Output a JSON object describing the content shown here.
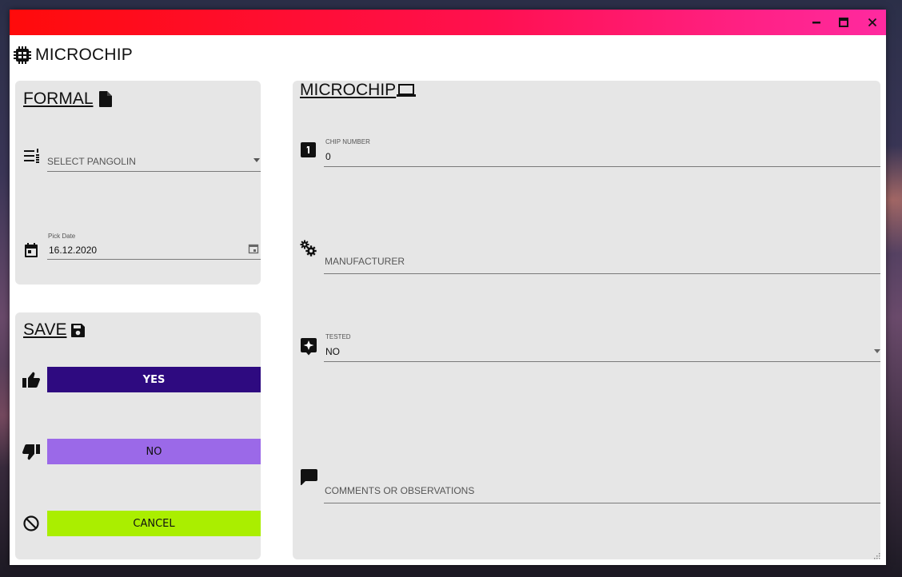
{
  "app": {
    "title": "MICROCHIP",
    "header_icon": "microchip-icon"
  },
  "window_controls": [
    "minimize-icon",
    "maximize-icon",
    "close-icon"
  ],
  "formal_card": {
    "title": "FORMAL",
    "title_icon": "file-icon",
    "pangolin_select": {
      "icon": "list-number-icon",
      "placeholder": "SELECT PANGOLIN",
      "value": ""
    },
    "date_picker": {
      "icon": "calendar-icon",
      "label": "Pick Date",
      "value": "16.12.2020"
    }
  },
  "save_card": {
    "title": "SAVE",
    "title_icon": "floppy-disk-icon",
    "buttons": [
      {
        "label": "YES",
        "icon": "thumbs-up-icon",
        "color": "#2e0a80",
        "text_color": "#ffffff"
      },
      {
        "label": "NO",
        "icon": "thumbs-down-icon",
        "color": "#9b69e8",
        "text_color": "#111111"
      },
      {
        "label": "CANCEL",
        "icon": "cancel-icon",
        "color": "#aaee00",
        "text_color": "#111111"
      }
    ]
  },
  "microchip_card": {
    "title": "MICROCHIP",
    "title_icon": "laptop-icon",
    "chip_number": {
      "icon": "numeric-one-box-icon",
      "label": "CHIP NUMBER",
      "value": "0"
    },
    "manufacturer": {
      "icon": "gears-icon",
      "placeholder": "MANUFACTURER",
      "value": ""
    },
    "tested": {
      "icon": "star-message-icon",
      "label": "TESTED",
      "value": "NO"
    },
    "comments": {
      "icon": "comment-icon",
      "placeholder": "COMMENTS OR OBSERVATIONS",
      "value": ""
    }
  },
  "colors": {
    "titlebar_start": "#ff0b0b",
    "titlebar_end": "#ff2aa0",
    "card_bg": "#e6e6e6"
  }
}
